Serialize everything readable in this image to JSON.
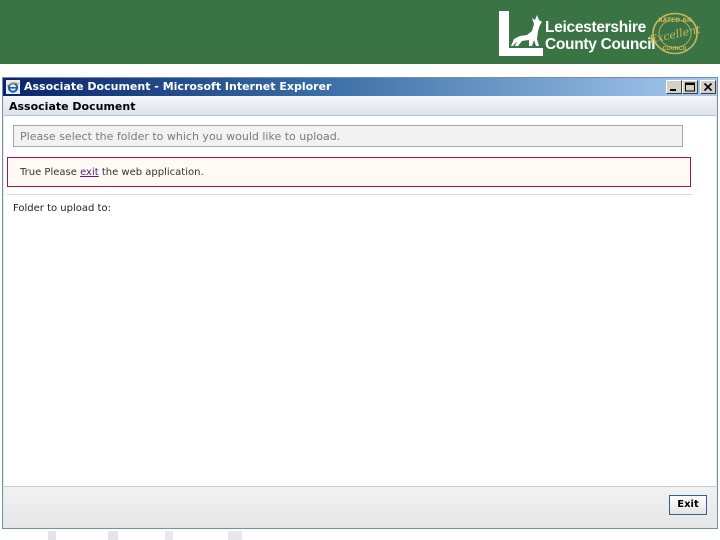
{
  "banner": {
    "logo_line1": "Leicestershire",
    "logo_line2": "County Council",
    "seal_text_top": "RATED AN",
    "seal_text_main": "Excellent",
    "seal_text_bottom": "COUNCIL",
    "brand_color": "#3a7444"
  },
  "window": {
    "title": "Associate Document - Microsoft Internet Explorer",
    "icon": "ie-icon",
    "controls": [
      "minimize-icon",
      "maximize-icon",
      "close-icon"
    ]
  },
  "page": {
    "heading": "Associate Document",
    "instruction": "Please select the folder to which you would like to upload.",
    "error": {
      "prefix": "True Please ",
      "link": "exit",
      "suffix": " the web application."
    },
    "folder_label": "Folder to upload to:",
    "exit_button": "Exit"
  }
}
